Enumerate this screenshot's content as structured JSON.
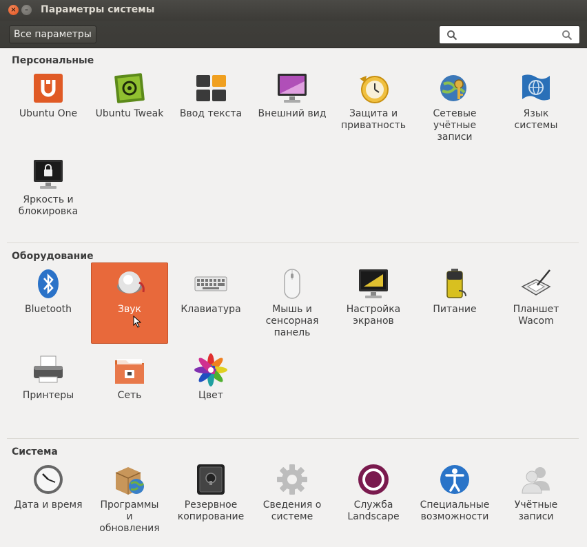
{
  "window": {
    "title": "Параметры системы"
  },
  "toolbar": {
    "all_settings": "Все параметры",
    "search_value": ""
  },
  "sections": {
    "personal": {
      "title": "Персональные",
      "items": [
        {
          "label": "Ubuntu One"
        },
        {
          "label": "Ubuntu Tweak"
        },
        {
          "label": "Ввод текста"
        },
        {
          "label": "Внешний вид"
        },
        {
          "label": "Защита и\nприватность"
        },
        {
          "label": "Сетевые\nучётные\nзаписи"
        },
        {
          "label": "Язык\nсистемы"
        },
        {
          "label": "Яркость и\nблокировка"
        }
      ]
    },
    "hardware": {
      "title": "Оборудование",
      "items": [
        {
          "label": "Bluetooth"
        },
        {
          "label": "Звук"
        },
        {
          "label": "Клавиатура"
        },
        {
          "label": "Мышь и\nсенсорная\nпанель"
        },
        {
          "label": "Настройка\nэкранов"
        },
        {
          "label": "Питание"
        },
        {
          "label": "Планшет\nWacom"
        },
        {
          "label": "Принтеры"
        },
        {
          "label": "Сеть"
        },
        {
          "label": "Цвет"
        }
      ]
    },
    "system": {
      "title": "Система",
      "items": [
        {
          "label": "Дата и время"
        },
        {
          "label": "Программы\nи\nобновления"
        },
        {
          "label": "Резервное\nкопирование"
        },
        {
          "label": "Сведения о\nсистеме"
        },
        {
          "label": "Служба\nLandscape"
        },
        {
          "label": "Специальные\nвозможности"
        },
        {
          "label": "Учётные\nзаписи"
        }
      ]
    }
  },
  "colors": {
    "selected_bg": "#e8693b",
    "titlebar": "#3c3b37",
    "window_bg": "#f2f1f0"
  }
}
